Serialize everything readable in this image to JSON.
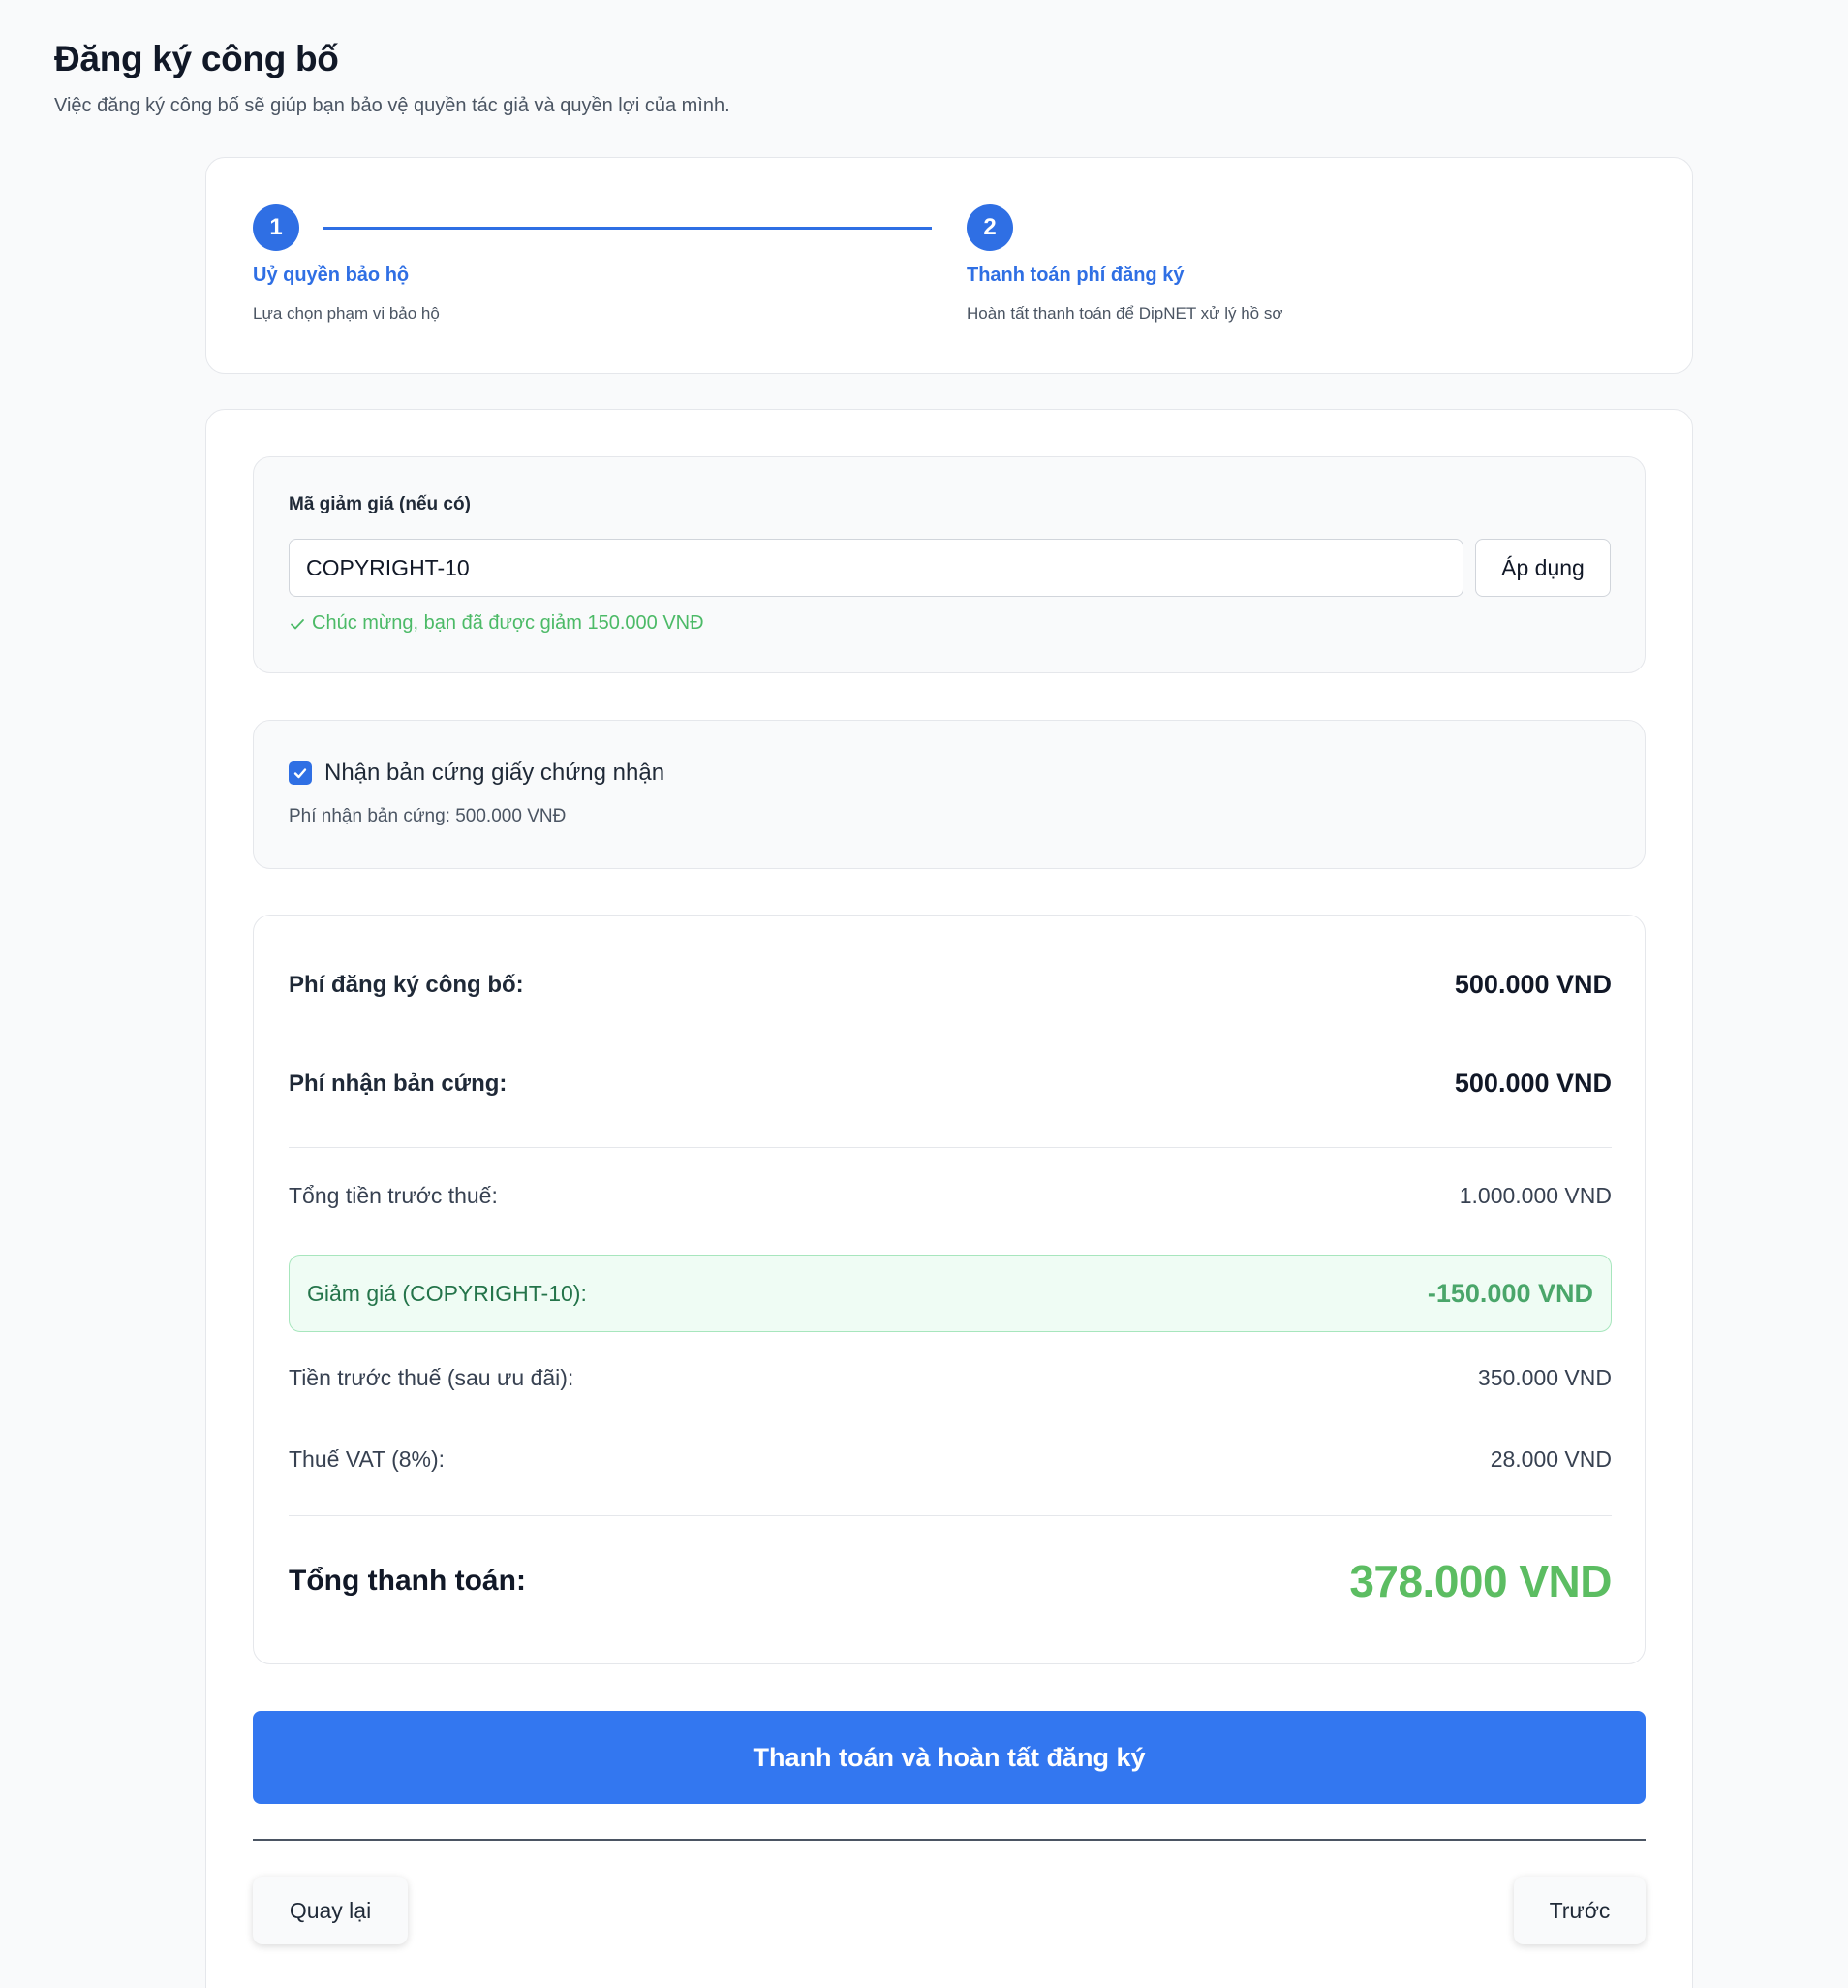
{
  "header": {
    "title": "Đăng ký công bố",
    "subtitle": "Việc đăng ký công bố sẽ giúp bạn bảo vệ quyền tác giả và quyền lợi của mình."
  },
  "stepper": {
    "steps": [
      {
        "number": "1",
        "title": "Uỷ quyền bảo hộ",
        "description": "Lựa chọn phạm vi bảo hộ"
      },
      {
        "number": "2",
        "title": "Thanh toán phí đăng ký",
        "description": "Hoàn tất thanh toán để DipNET xử lý hồ sơ"
      }
    ],
    "active_color": "#2f6fe4"
  },
  "coupon": {
    "label": "Mã giảm giá (nếu có)",
    "value": "COPYRIGHT-10",
    "apply_label": "Áp dụng",
    "success_message": "Chúc mừng, bạn đã được giảm 150.000 VNĐ"
  },
  "hardcopy": {
    "checked": true,
    "label": "Nhận bản cứng giấy chứng nhận",
    "fee_text": "Phí nhận bản cứng: 500.000 VNĐ"
  },
  "summary": {
    "registration_fee_label": "Phí đăng ký công bố:",
    "registration_fee_value": "500.000 VND",
    "hardcopy_fee_label": "Phí nhận bản cứng:",
    "hardcopy_fee_value": "500.000 VND",
    "subtotal_label": "Tổng tiền trước thuế:",
    "subtotal_value": "1.000.000 VND",
    "discount_label": "Giảm giá (COPYRIGHT-10):",
    "discount_value": "-150.000 VND",
    "after_discount_label": "Tiền trước thuế (sau ưu đãi):",
    "after_discount_value": "350.000 VND",
    "vat_label": "Thuế VAT (8%):",
    "vat_value": "28.000 VND",
    "total_label": "Tổng thanh toán:",
    "total_value": "378.000 VND"
  },
  "actions": {
    "pay_label": "Thanh toán và hoàn tất đăng ký",
    "back_label": "Quay lại",
    "prev_label": "Trước"
  },
  "colors": {
    "primary": "#3377f0",
    "success": "#4cba67",
    "total": "#5cbd62"
  }
}
